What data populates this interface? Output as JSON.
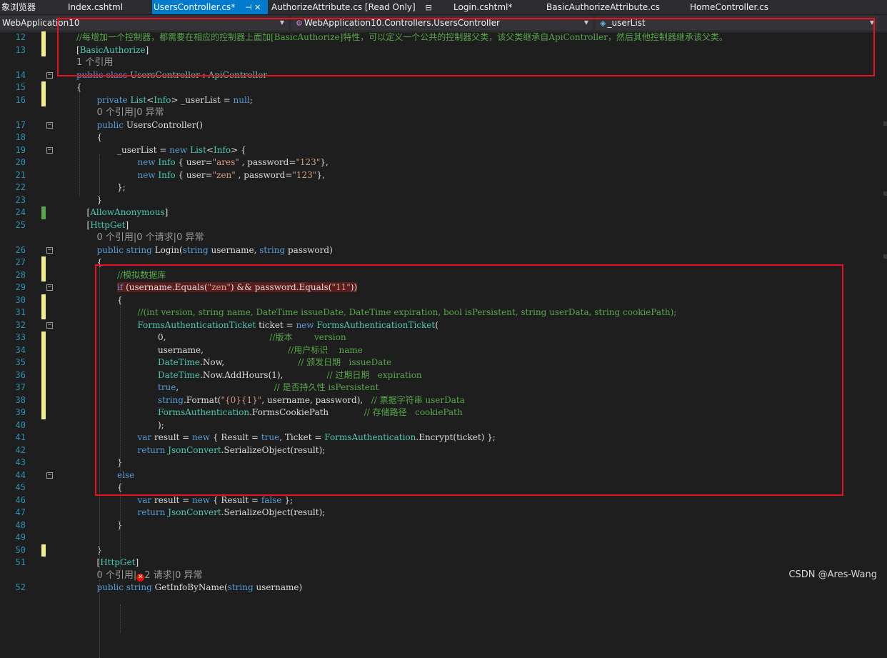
{
  "tabs": [
    {
      "label": "象浏览器",
      "active": false
    },
    {
      "label": "Index.cshtml",
      "active": false
    },
    {
      "label": "UsersController.cs*",
      "active": true,
      "extra": "⊣  ✕"
    },
    {
      "label": "AuthorizeAttribute.cs [Read Only]",
      "active": false,
      "extra": "⊟"
    },
    {
      "label": "Login.cshtml*",
      "active": false
    },
    {
      "label": "BasicAuthorizeAttribute.cs",
      "active": false
    },
    {
      "label": "HomeController.cs",
      "active": false
    }
  ],
  "nav": {
    "project": "WebApplication10",
    "type": "WebApplication10.Controllers.UsersController",
    "member": "_userList"
  },
  "lines": [
    {
      "n": "12",
      "chg": "y",
      "indent": 0,
      "tokens": [
        [
          "c",
          "//每增加一个控制器，都需要在相应的控制器上面加[BasicAuthorize]特性，可以定义一个公共的控制器父类，该父类继承自ApiController，然后其他控制器继承该父类。"
        ]
      ]
    },
    {
      "n": "13",
      "chg": "y",
      "indent": 0,
      "tokens": [
        [
          "p",
          "["
        ],
        [
          "a",
          "BasicAuthorize"
        ],
        [
          "p",
          "]"
        ]
      ]
    },
    {
      "n": "",
      "chg": "",
      "indent": 0,
      "lens": "1 个引用"
    },
    {
      "n": "14",
      "fold": "−",
      "indent": 0,
      "tokens": [
        [
          "k",
          "public class "
        ],
        [
          "t",
          "UsersController"
        ],
        [
          "p",
          " : "
        ],
        [
          "t",
          "ApiController"
        ]
      ]
    },
    {
      "n": "15",
      "chg": "y",
      "indent": 0,
      "tokens": [
        [
          "p",
          "{"
        ]
      ]
    },
    {
      "n": "16",
      "chg": "y",
      "indent": 1,
      "tokens": [
        [
          "k",
          "private "
        ],
        [
          "t",
          "List"
        ],
        [
          "p",
          "<"
        ],
        [
          "t",
          "Info"
        ],
        [
          "p",
          "> _userList = "
        ],
        [
          "k",
          "null"
        ],
        [
          "p",
          ";"
        ]
      ]
    },
    {
      "n": "",
      "indent": 1,
      "lens": "0 个引用|0 异常"
    },
    {
      "n": "17",
      "fold": "−",
      "indent": 1,
      "tokens": [
        [
          "k",
          "public "
        ],
        [
          "p",
          "UsersController()"
        ]
      ]
    },
    {
      "n": "18",
      "indent": 1,
      "tokens": [
        [
          "p",
          "{"
        ]
      ]
    },
    {
      "n": "19",
      "fold": "−",
      "indent": 2,
      "tokens": [
        [
          "p",
          "_userList = "
        ],
        [
          "k",
          "new "
        ],
        [
          "t",
          "List"
        ],
        [
          "p",
          "<"
        ],
        [
          "t",
          "Info"
        ],
        [
          "p",
          "> {"
        ]
      ]
    },
    {
      "n": "20",
      "indent": 3,
      "tokens": [
        [
          "k",
          "new "
        ],
        [
          "t",
          "Info"
        ],
        [
          "p",
          " { user="
        ],
        [
          "s",
          "\"ares\""
        ],
        [
          "p",
          " , password="
        ],
        [
          "s",
          "\"123\""
        ],
        [
          "p",
          "},"
        ]
      ]
    },
    {
      "n": "21",
      "indent": 3,
      "tokens": [
        [
          "k",
          "new "
        ],
        [
          "t",
          "Info"
        ],
        [
          "p",
          " { user="
        ],
        [
          "s",
          "\"zen\""
        ],
        [
          "p",
          " , password="
        ],
        [
          "s",
          "\"123\""
        ],
        [
          "p",
          "},"
        ]
      ]
    },
    {
      "n": "22",
      "indent": 2,
      "tokens": [
        [
          "p",
          "};"
        ]
      ]
    },
    {
      "n": "23",
      "indent": 1,
      "tokens": [
        [
          "p",
          "}"
        ]
      ]
    },
    {
      "n": "24",
      "chg": "g",
      "indent": 1,
      "extra": -14,
      "tokens": [
        [
          "p",
          "["
        ],
        [
          "a",
          "AllowAnonymous"
        ],
        [
          "p",
          "]"
        ]
      ]
    },
    {
      "n": "25",
      "indent": 1,
      "extra": -14,
      "tokens": [
        [
          "p",
          "["
        ],
        [
          "a",
          "HttpGet"
        ],
        [
          "p",
          "]"
        ]
      ]
    },
    {
      "n": "",
      "indent": 1,
      "lens": "0 个引用|0 个请求|0 异常"
    },
    {
      "n": "26",
      "fold": "−",
      "indent": 1,
      "tokens": [
        [
          "k",
          "public string "
        ],
        [
          "p",
          "Login("
        ],
        [
          "k",
          "string "
        ],
        [
          "p",
          "username, "
        ],
        [
          "k",
          "string "
        ],
        [
          "p",
          "password)"
        ]
      ]
    },
    {
      "n": "27",
      "chg": "y",
      "indent": 1,
      "tokens": [
        [
          "p",
          "{"
        ]
      ]
    },
    {
      "n": "28",
      "chg": "y",
      "indent": 2,
      "tokens": [
        [
          "c",
          "//模拟数据库"
        ]
      ]
    },
    {
      "n": "29",
      "fold": "−",
      "indent": 2,
      "hl": true,
      "tokens": [
        [
          "k",
          "if "
        ],
        [
          "p",
          "(username.Equals("
        ],
        [
          "s",
          "\"zen\""
        ],
        [
          "p",
          ") && password.Equals("
        ],
        [
          "s",
          "\"11\""
        ],
        [
          "p",
          "))"
        ]
      ]
    },
    {
      "n": "30",
      "chg": "y",
      "indent": 2,
      "tokens": [
        [
          "p",
          "{"
        ]
      ]
    },
    {
      "n": "31",
      "chg": "y",
      "indent": 3,
      "tokens": [
        [
          "c",
          "//(int version, string name, DateTime issueDate, DateTime expiration, bool isPersistent, string userData, string cookiePath);"
        ]
      ]
    },
    {
      "n": "32",
      "fold": "−",
      "indent": 3,
      "tokens": [
        [
          "t",
          "FormsAuthenticationTicket"
        ],
        [
          "p",
          " ticket = "
        ],
        [
          "k",
          "new "
        ],
        [
          "t",
          "FormsAuthenticationTicket"
        ],
        [
          "p",
          "("
        ]
      ]
    },
    {
      "n": "33",
      "chg": "y",
      "indent": 4,
      "tokens": [
        [
          "p",
          "0,                                      "
        ],
        [
          "c",
          "//版本        version"
        ]
      ]
    },
    {
      "n": "34",
      "chg": "y",
      "indent": 4,
      "tokens": [
        [
          "p",
          "username,                               "
        ],
        [
          "c",
          "//用户标识    name"
        ]
      ]
    },
    {
      "n": "35",
      "chg": "y",
      "indent": 4,
      "tokens": [
        [
          "t",
          "DateTime"
        ],
        [
          "p",
          ".Now,                           "
        ],
        [
          "c",
          "// 颁发日期   issueDate"
        ]
      ]
    },
    {
      "n": "36",
      "chg": "y",
      "indent": 4,
      "tokens": [
        [
          "t",
          "DateTime"
        ],
        [
          "p",
          ".Now.AddHours(1),                "
        ],
        [
          "c",
          "// 过期日期   expiration"
        ]
      ]
    },
    {
      "n": "37",
      "chg": "y",
      "indent": 4,
      "tokens": [
        [
          "k",
          "true"
        ],
        [
          "p",
          ",                                   "
        ],
        [
          "c",
          "// 是否持久性 isPersistent"
        ]
      ]
    },
    {
      "n": "38",
      "chg": "y",
      "indent": 4,
      "tokens": [
        [
          "k",
          "string"
        ],
        [
          "p",
          ".Format("
        ],
        [
          "s",
          "\"{0}{1}\""
        ],
        [
          "p",
          ", username, password),   "
        ],
        [
          "c",
          "// 票据字符串 userData"
        ]
      ]
    },
    {
      "n": "39",
      "chg": "y",
      "indent": 4,
      "tokens": [
        [
          "t",
          "FormsAuthentication"
        ],
        [
          "p",
          ".FormsCookiePath             "
        ],
        [
          "c",
          "// 存储路径   cookiePath"
        ]
      ]
    },
    {
      "n": "40",
      "indent": 4,
      "tokens": [
        [
          "p",
          ");"
        ]
      ]
    },
    {
      "n": "41",
      "indent": 3,
      "tokens": [
        [
          "k",
          "var "
        ],
        [
          "p",
          "result = "
        ],
        [
          "k",
          "new "
        ],
        [
          "p",
          "{ Result = "
        ],
        [
          "k",
          "true"
        ],
        [
          "p",
          ", Ticket = "
        ],
        [
          "t",
          "FormsAuthentication"
        ],
        [
          "p",
          ".Encrypt(ticket) };"
        ]
      ]
    },
    {
      "n": "42",
      "indent": 3,
      "tokens": [
        [
          "k",
          "return "
        ],
        [
          "t",
          "JsonConvert"
        ],
        [
          "p",
          ".SerializeObject(result);"
        ]
      ]
    },
    {
      "n": "43",
      "indent": 2,
      "tokens": [
        [
          "p",
          "}"
        ]
      ]
    },
    {
      "n": "44",
      "fold": "−",
      "indent": 2,
      "tokens": [
        [
          "k",
          "else"
        ]
      ]
    },
    {
      "n": "45",
      "indent": 2,
      "tokens": [
        [
          "p",
          "{"
        ]
      ]
    },
    {
      "n": "46",
      "indent": 3,
      "tokens": [
        [
          "k",
          "var "
        ],
        [
          "p",
          "result = "
        ],
        [
          "k",
          "new "
        ],
        [
          "p",
          "{ Result = "
        ],
        [
          "k",
          "false "
        ],
        [
          "p",
          "};"
        ]
      ]
    },
    {
      "n": "47",
      "indent": 3,
      "tokens": [
        [
          "k",
          "return "
        ],
        [
          "t",
          "JsonConvert"
        ],
        [
          "p",
          ".SerializeObject(result);"
        ]
      ]
    },
    {
      "n": "48",
      "indent": 2,
      "tokens": [
        [
          "p",
          "}"
        ]
      ]
    },
    {
      "n": "49",
      "indent": 2,
      "tokens": []
    },
    {
      "n": "50",
      "chg": "y",
      "indent": 1,
      "tokens": [
        [
          "p",
          "}"
        ]
      ]
    },
    {
      "n": "51",
      "indent": 1,
      "tokens": [
        [
          "p",
          "["
        ],
        [
          "a",
          "HttpGet"
        ],
        [
          "p",
          "]"
        ]
      ]
    },
    {
      "n": "",
      "indent": 1,
      "lens": "0 个引用|",
      "lens_err": "2 请求|0 异常"
    },
    {
      "n": "52",
      "indent": 1,
      "tokens": [
        [
          "k",
          "public string "
        ],
        [
          "p",
          "GetInfoByName("
        ],
        [
          "k",
          "string "
        ],
        [
          "p",
          "username)"
        ]
      ]
    }
  ],
  "icons": {
    "error": "error-circle-icon",
    "fold": "collapse-icon",
    "class_member": "field-icon"
  },
  "watermark": "CSDN @Ares-Wang",
  "colors": {
    "keyword": "#569cd6",
    "type": "#4ec9b0",
    "string": "#d69d85",
    "comment": "#57a64a",
    "linenum": "#2b91af",
    "annotation_box": "#e81123"
  }
}
